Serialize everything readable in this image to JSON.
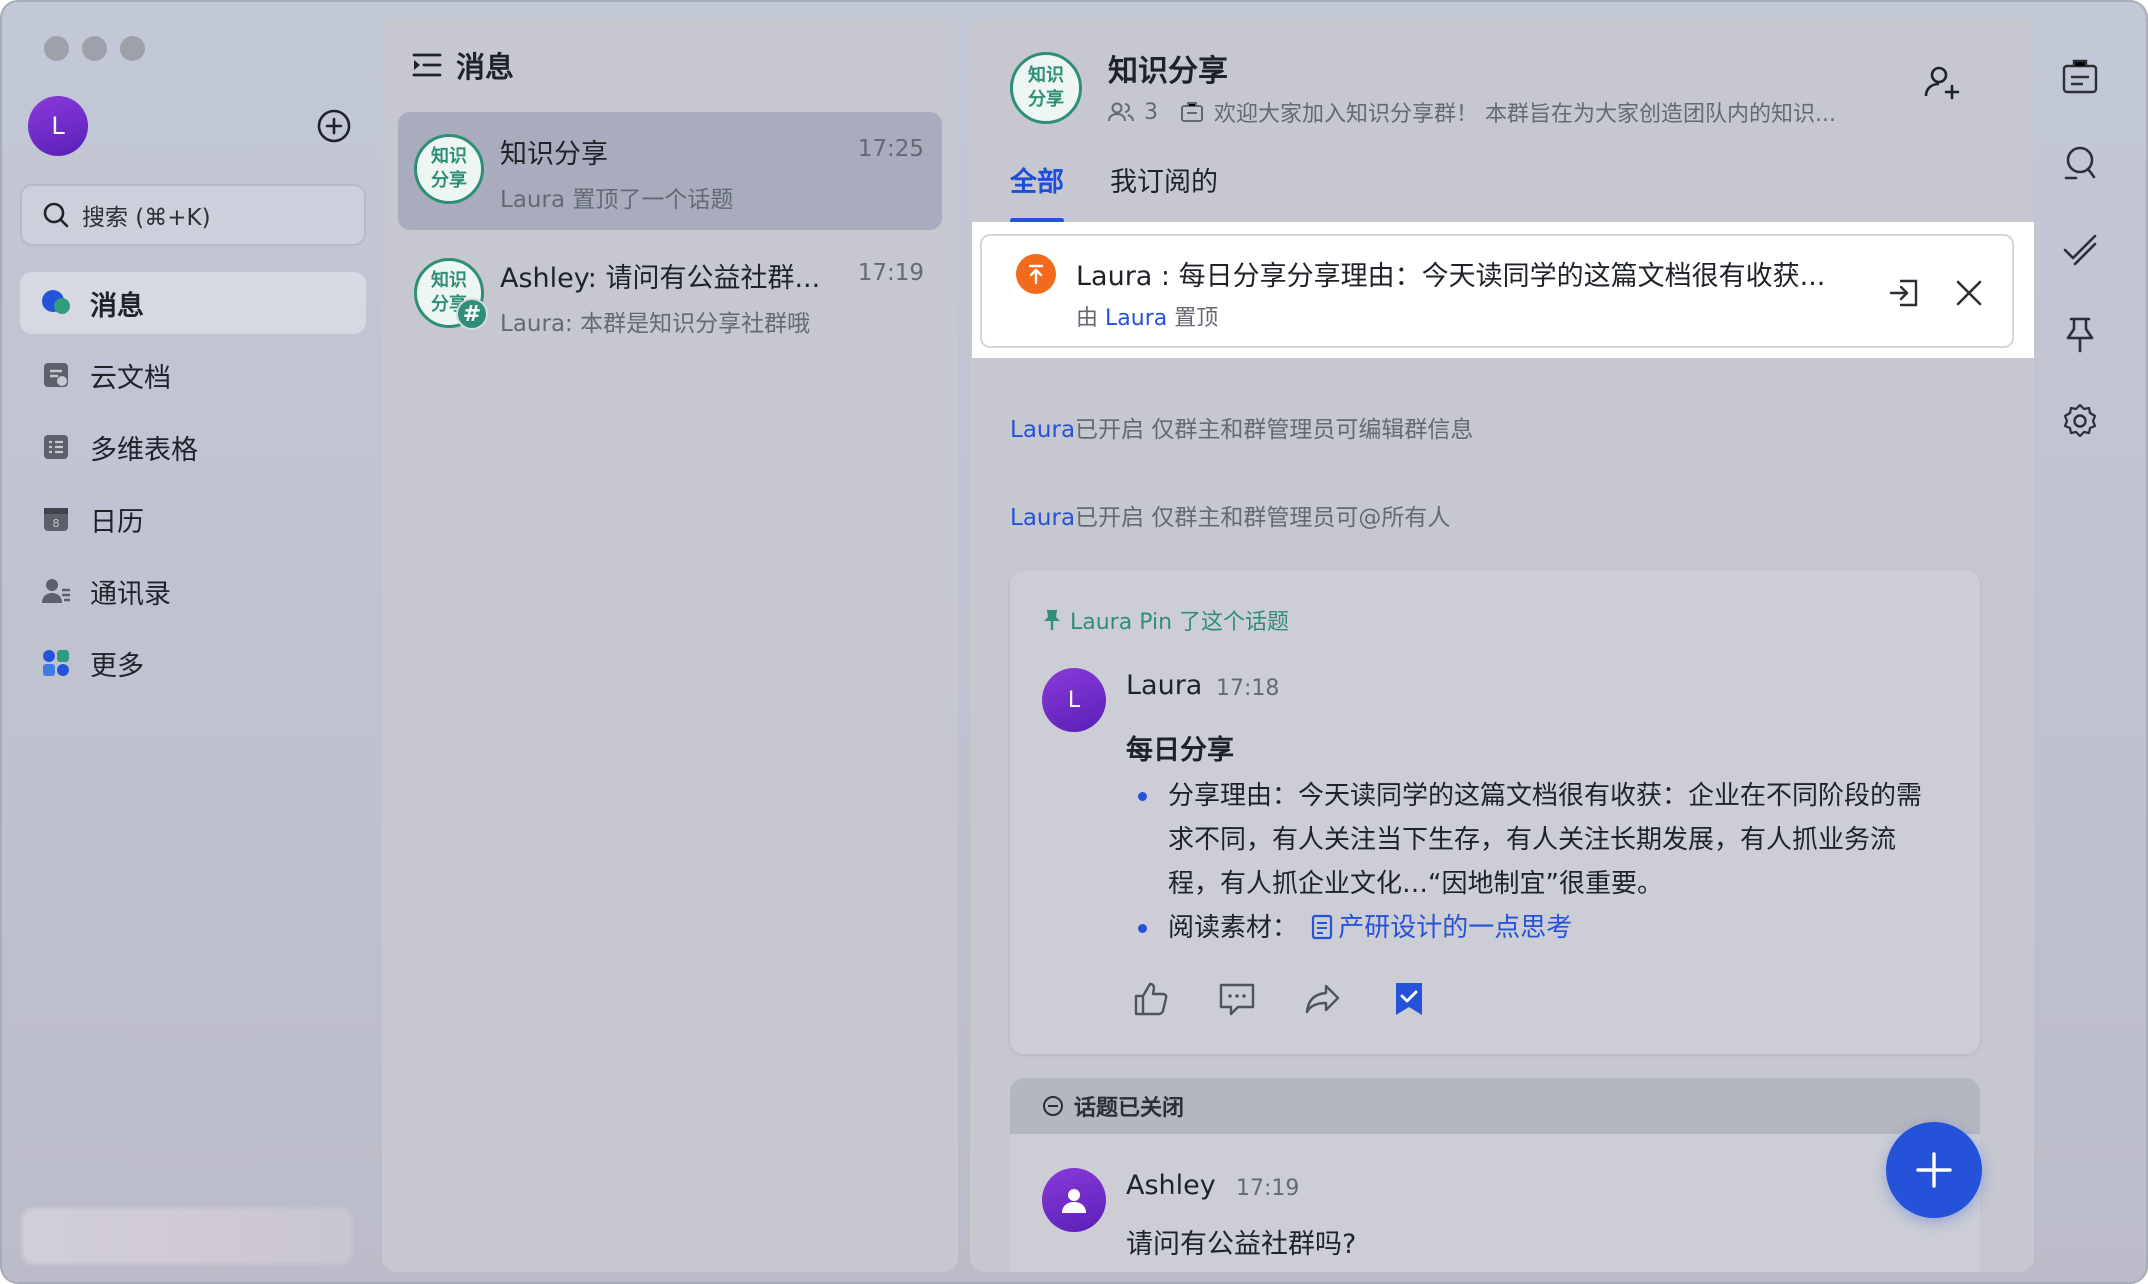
{
  "sidebar": {
    "avatar_letter": "L",
    "search_placeholder": "搜索 (⌘+K)",
    "nav": [
      {
        "label": "消息",
        "icon": "chat-bubble-icon",
        "active": true
      },
      {
        "label": "云文档",
        "icon": "cloud-doc-icon"
      },
      {
        "label": "多维表格",
        "icon": "table-icon"
      },
      {
        "label": "日历",
        "icon": "calendar-icon"
      },
      {
        "label": "通讯录",
        "icon": "contacts-icon"
      },
      {
        "label": "更多",
        "icon": "more-apps-icon"
      }
    ]
  },
  "list": {
    "header": "消息",
    "chats": [
      {
        "avatar_text": "知识分享",
        "title": "知识分享",
        "time": "17:25",
        "subtitle": "Laura 置顶了一个话题",
        "selected": true
      },
      {
        "avatar_text": "知识分享",
        "title": "Ashley: 请问有公益社群...",
        "time": "17:19",
        "subtitle": "Laura: 本群是知识分享社群哦",
        "badge": "#"
      }
    ]
  },
  "main": {
    "title": "知识分享",
    "member_count": "3",
    "announcement": "欢迎大家加入知识分享群！ 本群旨在为大家创造团队内的知识...",
    "tabs": [
      "全部",
      "我订阅的"
    ],
    "pinned": {
      "text": "Laura : 每日分享分享理由：今天读同学的这篇文档很有收获...",
      "by_prefix": "由",
      "by_user": "Laura",
      "by_suffix": "置顶"
    },
    "system_lines": [
      {
        "who": "Laura",
        "text": "已开启 仅群主和群管理员可编辑群信息"
      },
      {
        "who": "Laura",
        "text": "已开启 仅群主和群管理员可@所有人"
      }
    ],
    "topic": {
      "pin_note": "Laura Pin 了这个话题",
      "author": "Laura",
      "author_initial": "L",
      "time": "17:18",
      "heading": "每日分享",
      "bullet1": "分享理由：今天读同学的这篇文档很有收获：企业在不同阶段的需求不同，有人关注当下生存，有人关注长期发展，有人抓业务流程，有人抓企业文化…“因地制宜”很重要。",
      "bullet2_prefix": "阅读素材：",
      "bullet2_link": "产研设计的一点思考"
    },
    "closed_topic": {
      "bar": "话题已关闭",
      "author": "Ashley",
      "time": "17:19",
      "text": "请问有公益社群吗?"
    }
  },
  "colors": {
    "accent": "#2453d9",
    "group_green": "#2f8f76",
    "pin_orange": "#f26b1d",
    "avatar_purple": "#6a28c8"
  }
}
